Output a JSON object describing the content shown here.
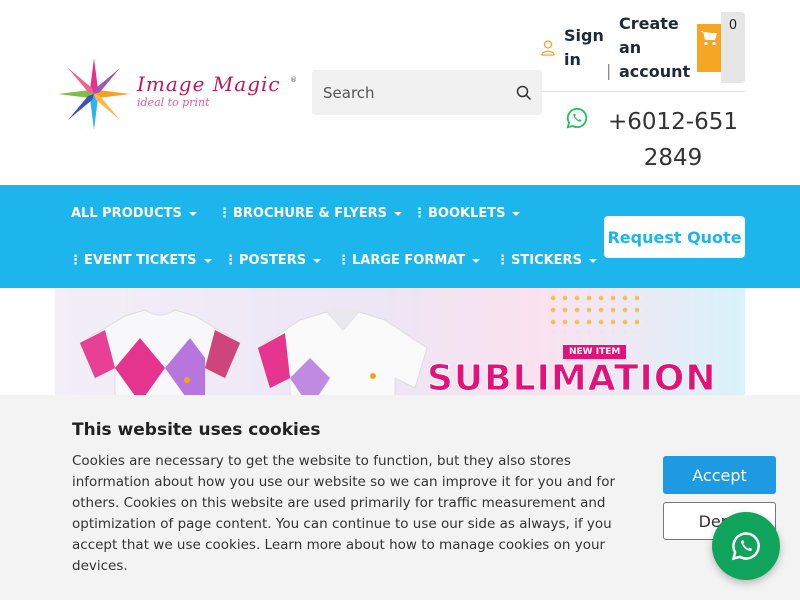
{
  "brand": {
    "name": "Image Magic",
    "tagline": "ideal to print",
    "reg": "®"
  },
  "search": {
    "placeholder": "Search"
  },
  "account": {
    "sign_in": "Sign in",
    "separator": "|",
    "create": "Create an account"
  },
  "cart": {
    "count": "0"
  },
  "contact": {
    "phone": "+6012-651 2849"
  },
  "nav": {
    "items": [
      {
        "label": "ALL PRODUCTS",
        "dots": false
      },
      {
        "label": "BROCHURE & FLYERS",
        "dots": true
      },
      {
        "label": "BOOKLETS",
        "dots": true
      },
      {
        "label": "EVENT TICKETS",
        "dots": true
      },
      {
        "label": "POSTERS",
        "dots": true
      },
      {
        "label": "LARGE FORMAT",
        "dots": true
      },
      {
        "label": "STICKERS",
        "dots": true
      }
    ],
    "quote_button": "Request Quote"
  },
  "banner": {
    "badge": "NEW ITEM",
    "headline": "SUBLIMATION"
  },
  "cookies": {
    "title": "This website uses cookies",
    "body": "Cookies are necessary to get the website to function, but they also stores information about how you use our website so we can improve it for you and for others. Cookies on this website are used primarily for traffic measurement and optimization of page content. You can continue to use our side as always, if you accept that we use cookies. Learn more about how to manage cookies on your devices.",
    "accept": "Accept",
    "deny": "Deny"
  },
  "colors": {
    "nav_bg": "#1cb5ec",
    "cart": "#f5a623",
    "accept": "#1e9ae3",
    "whatsapp_float": "#10a35c",
    "brand_pink": "#c2185b"
  }
}
